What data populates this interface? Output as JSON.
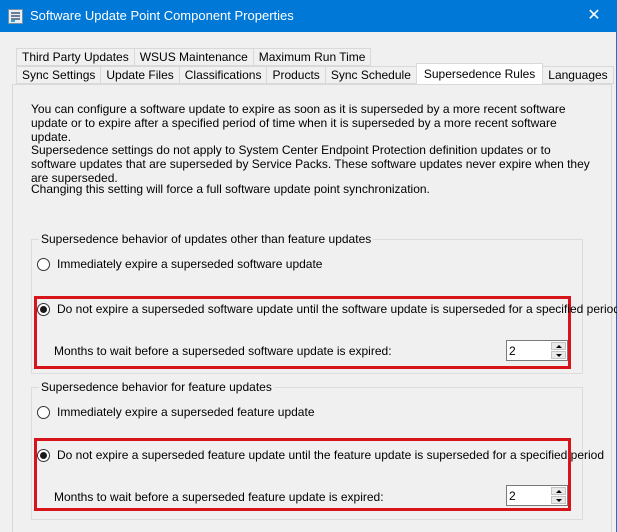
{
  "window": {
    "title": "Software Update Point Component Properties",
    "icon": "properties-window-icon",
    "close_glyph": "✕"
  },
  "tabs": {
    "row1": [
      {
        "label": "Third Party Updates"
      },
      {
        "label": "WSUS Maintenance"
      },
      {
        "label": "Maximum Run Time"
      }
    ],
    "row2": [
      {
        "label": "Sync Settings"
      },
      {
        "label": "Update Files"
      },
      {
        "label": "Classifications"
      },
      {
        "label": "Products"
      },
      {
        "label": "Sync Schedule"
      },
      {
        "label": "Supersedence Rules",
        "active": true
      },
      {
        "label": "Languages"
      }
    ]
  },
  "intro": {
    "p1": "You can configure a software update to expire as soon as it is superseded by a more recent software update or to expire after a specified period of time when it is superseded by a more recent software update.",
    "p2": "Supersedence settings do not apply to System Center Endpoint Protection definition updates or to software updates that are superseded by Service Packs. These software updates never expire when they are superseded.",
    "p3": "Changing this setting will force a full software update point synchronization."
  },
  "groups": [
    {
      "legend": "Supersedence behavior of updates other than feature updates",
      "option_immediate": "Immediately expire a superseded software update",
      "option_delay": "Do not expire a superseded software update until the software update is superseded for a specified period",
      "selected": "delay",
      "months_label": "Months to wait before a superseded software update is expired:",
      "months_value": "2"
    },
    {
      "legend": "Supersedence behavior for feature updates",
      "option_immediate": "Immediately expire a superseded feature update",
      "option_delay": "Do not expire a superseded feature update until the feature update is superseded for a specified period",
      "selected": "delay",
      "months_label": "Months to wait before a superseded feature update is expired:",
      "months_value": "2"
    }
  ],
  "colors": {
    "titlebar": "#0078d7",
    "highlight_border": "#d7141a"
  }
}
